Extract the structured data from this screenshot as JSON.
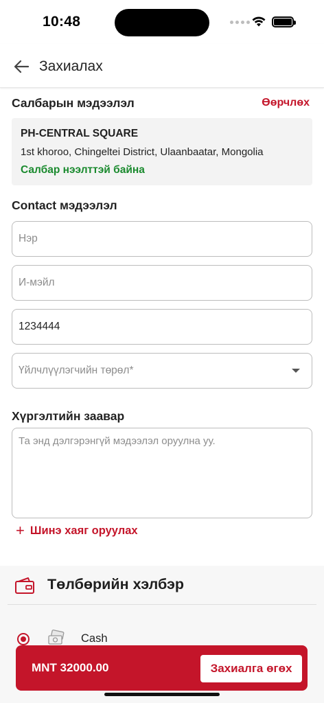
{
  "status_bar": {
    "time": "10:48"
  },
  "nav": {
    "title": "Захиалах"
  },
  "branch": {
    "section_title": "Салбарын мэдээлэл",
    "edit_label": "Өөрчлөх",
    "name": "PH-CENTRAL SQUARE",
    "address": "1st khoroo, Chingeltei District, Ulaanbaatar, Mongolia",
    "status": "Салбар нээлттэй байна"
  },
  "contact": {
    "section_title": "Contact мэдээлэл",
    "name_placeholder": "Нэр",
    "email_placeholder": "И-мэйл",
    "phone_value": "1234444",
    "customer_type_placeholder": "Үйлчлүүлэгчийн төрөл*"
  },
  "delivery": {
    "section_title": "Хүргэлтийн заавар",
    "instructions_placeholder": "Та энд дэлгэрэнгүй мэдээлэл оруулна уу.",
    "add_address_label": "Шинэ хаяг оруулах"
  },
  "payment": {
    "section_title": "Төлбөрийн хэлбэр",
    "options": [
      {
        "label": "Cash",
        "selected": true
      }
    ]
  },
  "checkout": {
    "total": "MNT 32000.00",
    "order_button": "Захиалга өгөх"
  },
  "colors": {
    "accent": "#c4152a",
    "open_status": "#1a8a2e"
  },
  "icons": [
    "back-arrow-icon",
    "card-icon",
    "cash-icon",
    "radio-selected-icon",
    "wifi-icon",
    "battery-icon",
    "chevron-down-icon",
    "plus-icon"
  ]
}
